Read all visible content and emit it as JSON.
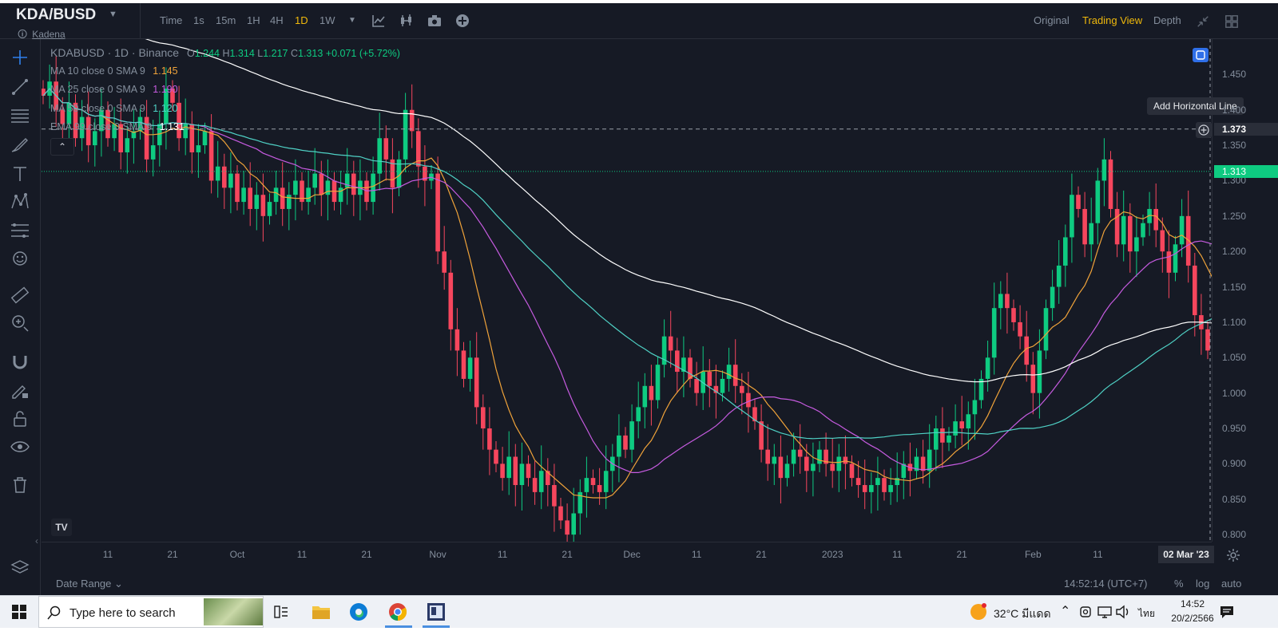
{
  "header": {
    "pair": "KDA/BUSD",
    "sub_name": "Kadena",
    "intervals": [
      {
        "label": "Time",
        "active": false
      },
      {
        "label": "1s",
        "active": false
      },
      {
        "label": "15m",
        "active": false
      },
      {
        "label": "1H",
        "active": false
      },
      {
        "label": "4H",
        "active": false
      },
      {
        "label": "1D",
        "active": true
      },
      {
        "label": "1W",
        "active": false
      }
    ],
    "views": [
      {
        "label": "Original",
        "active": false
      },
      {
        "label": "Trading View",
        "active": true
      },
      {
        "label": "Depth",
        "active": false
      }
    ]
  },
  "legend": {
    "symbol_line": "KDABUSD · 1D · Binance",
    "open_label": "O",
    "open": "1.244",
    "high_label": "H",
    "high": "1.314",
    "low_label": "L",
    "low": "1.217",
    "close_label": "C",
    "close": "1.313",
    "change": "+0.071 (+5.72%)",
    "indicators": [
      {
        "label": "MA 10 close 0 SMA 9",
        "value": "1.145",
        "color": "#f0a33a"
      },
      {
        "label": "MA 25 close 0 SMA 9",
        "value": "1.190",
        "color": "#c65be0"
      },
      {
        "label": "MA 50 close 0 SMA 9",
        "value": "1.120",
        "color": "#4fd1c5"
      },
      {
        "label": "EMA 99 close 0 SMA 9",
        "value": "1.131",
        "color": "#ffffff"
      }
    ]
  },
  "chart": {
    "tooltip": "Add Horizontal Line",
    "crosshair_price": "1.373",
    "last_price": "1.313",
    "price_ticks": [
      "1.450",
      "1.400",
      "1.350",
      "1.300",
      "1.250",
      "1.200",
      "1.150",
      "1.100",
      "1.050",
      "1.000",
      "0.950",
      "0.900",
      "0.850",
      "0.800"
    ],
    "time_ticks": [
      "11",
      "21",
      "Oct",
      "11",
      "21",
      "Nov",
      "11",
      "21",
      "Dec",
      "11",
      "21",
      "2023",
      "11",
      "21",
      "Feb",
      "11"
    ],
    "crosshair_date": "02 Mar '23",
    "up_color": "#0ecb81",
    "down_color": "#f6465d",
    "watermark": "TV"
  },
  "bottom": {
    "date_range": "Date Range",
    "clock": "14:52:14 (UTC+7)",
    "percent": "%",
    "log": "log",
    "auto": "auto"
  },
  "taskbar": {
    "search_placeholder": "Type here to search",
    "weather": "32°C มีแดด",
    "lang": "ไทย",
    "time": "14:52",
    "date": "20/2/2566"
  }
}
